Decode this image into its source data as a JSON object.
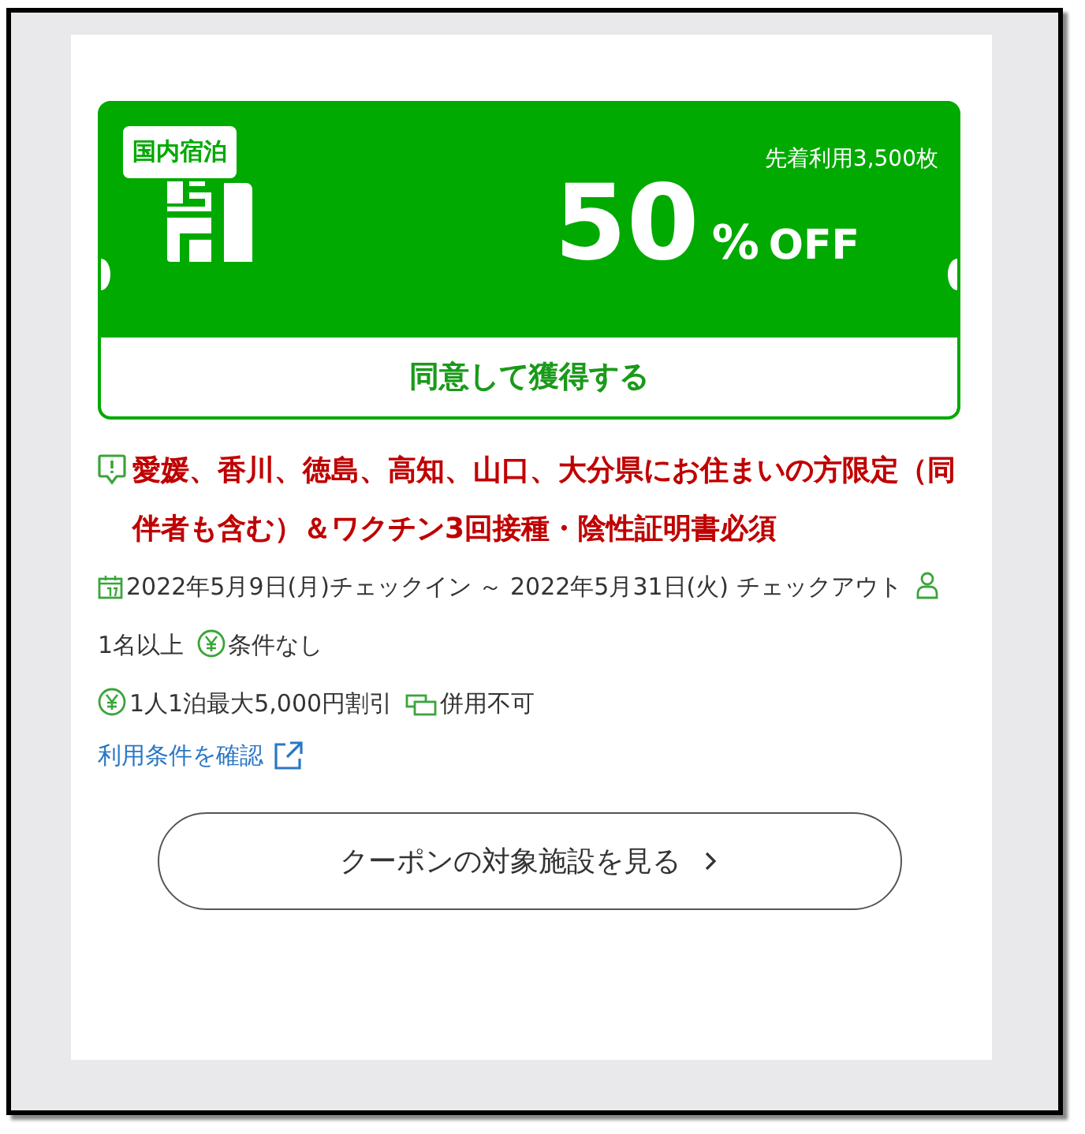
{
  "coupon": {
    "category": "国内宿泊",
    "limit": "先着利用3,500枚",
    "discount": "50",
    "unit": "%",
    "off": "OFF",
    "action": "同意して獲得する"
  },
  "notice": "愛媛、香川、徳島、高知、山口、大分県にお住まいの方限定（同伴者も含む）＆ワクチン3回接種・陰性証明書必須",
  "detail_rows": [
    {
      "items": [
        {
          "kind": "date",
          "text": "2022年5月9日(月)チェックイン ～ 2022年5月31日(火) チェックアウト"
        },
        {
          "kind": "people",
          "text": "1名以上"
        },
        {
          "kind": "yen",
          "text": "条件なし"
        }
      ]
    },
    {
      "items": [
        {
          "kind": "yen",
          "text": "1人1泊最大5,000円割引"
        },
        {
          "kind": "combine",
          "text": "併用不可"
        }
      ]
    }
  ],
  "terms_link": "利用条件を確認",
  "facilities_button": "クーポンの対象施設を見る"
}
